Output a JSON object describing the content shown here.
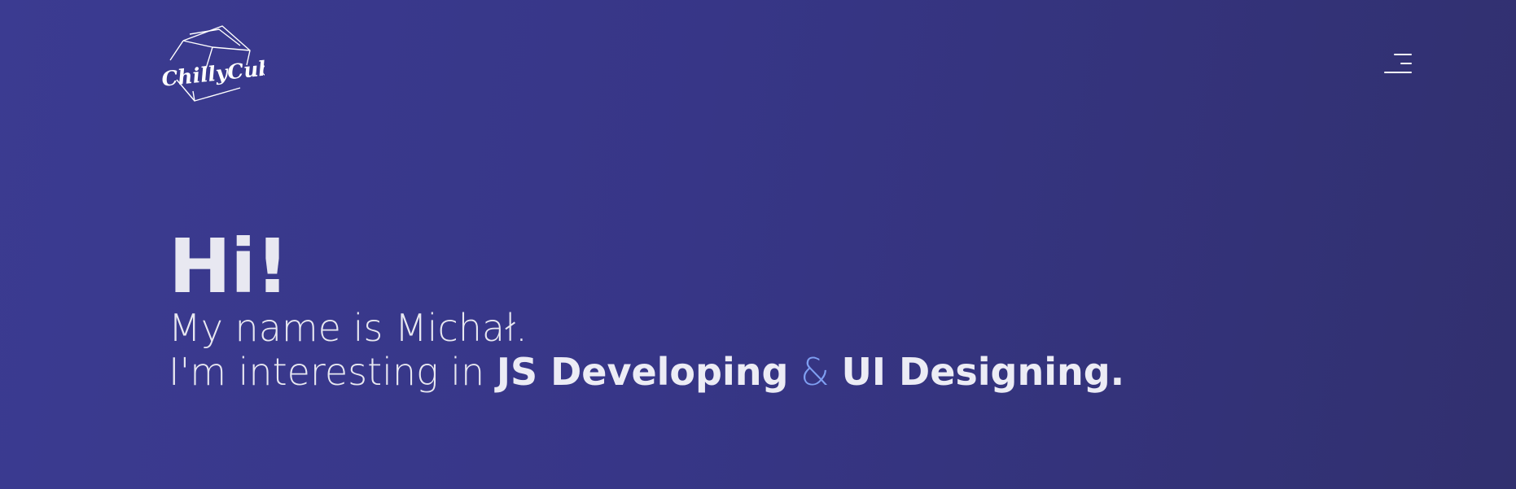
{
  "brand": {
    "logo_text": "ChillyCube",
    "logo_icon": "cube-icon"
  },
  "nav": {
    "menu_icon": "hamburger-menu-icon"
  },
  "hero": {
    "title": "Hi!",
    "line1": "My name is Michał.",
    "line2_prefix": "I'm interesting in ",
    "skill1": "JS Developing",
    "separator": "&",
    "skill2": "UI Designing."
  },
  "colors": {
    "background_start": "#3b3b91",
    "background_end": "#31306f",
    "text": "#e8e8f1",
    "accent": "#7f9ff2"
  }
}
